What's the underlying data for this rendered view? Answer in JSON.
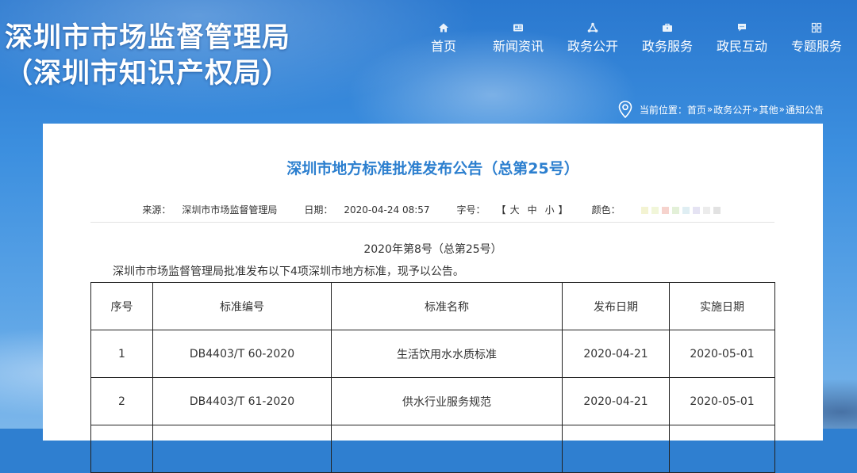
{
  "header": {
    "title_line1": "深圳市市场监督管理局",
    "title_line2": "（深圳市知识产权局）"
  },
  "nav": {
    "items": [
      {
        "label": "首页",
        "icon": "home-icon"
      },
      {
        "label": "新闻资讯",
        "icon": "news-icon"
      },
      {
        "label": "政务公开",
        "icon": "share-icon"
      },
      {
        "label": "政务服务",
        "icon": "briefcase-icon"
      },
      {
        "label": "政民互动",
        "icon": "chat-icon"
      },
      {
        "label": "专题服务",
        "icon": "grid-icon"
      }
    ]
  },
  "breadcrumb": {
    "prefix": "当前位置：",
    "items": [
      "首页",
      "政务公开",
      "其他",
      "通知公告"
    ],
    "separator": "»"
  },
  "article": {
    "title": "深圳市地方标准批准发布公告（总第25号）",
    "meta": {
      "source_label": "来源：",
      "source_value": "深圳市市场监督管理局",
      "date_label": "日期：",
      "date_value": "2020-04-24 08:57",
      "size_label": "字号：",
      "size_open": "【",
      "size_large": "大",
      "size_medium": "中",
      "size_small": "小",
      "size_close": "】",
      "color_label": "颜色：",
      "color_swatches": [
        "#f3f3d2",
        "#f1f6d9",
        "#f6d3cd",
        "#e3f0d8",
        "#dfeef3",
        "#e5e3f3",
        "#ececec",
        "#e2e2e2"
      ]
    },
    "subtitle": "2020年第8号（总第25号）",
    "intro": "深圳市市场监督管理局批准发布以下4项深圳市地方标准，现予以公告。",
    "table": {
      "headers": [
        "序号",
        "标准编号",
        "标准名称",
        "发布日期",
        "实施日期"
      ],
      "rows": [
        [
          "1",
          "DB4403/T 60-2020",
          "生活饮用水水质标准",
          "2020-04-21",
          "2020-05-01"
        ],
        [
          "2",
          "DB4403/T 61-2020",
          "供水行业服务规范",
          "2020-04-21",
          "2020-05-01"
        ]
      ]
    }
  }
}
